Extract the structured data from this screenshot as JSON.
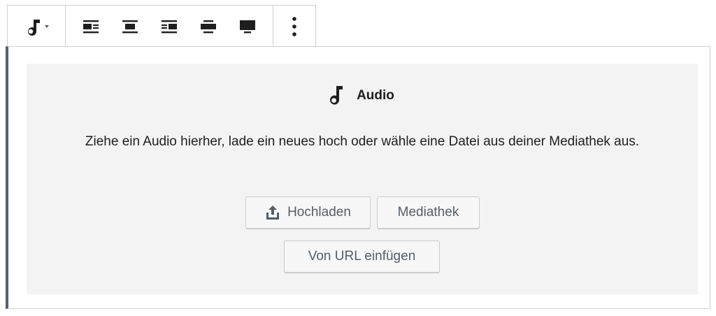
{
  "block": {
    "title": "Audio",
    "instructions": "Ziehe ein Audio hierher, lade ein neues hoch oder wähle eine Datei aus deiner Mediathek aus.",
    "upload_label": "Hochladen",
    "library_label": "Mediathek",
    "url_label": "Von URL einfügen"
  },
  "toolbar": {
    "icons": [
      "music-note-icon",
      "dropdown-caret-icon",
      "align-left-icon",
      "align-center-icon",
      "align-right-icon",
      "align-wide-icon",
      "align-full-icon",
      "more-options-icon"
    ]
  },
  "colors": {
    "frame_accent": "#5a6069",
    "placeholder_bg": "#f3f3f3",
    "button_text": "#555d66",
    "icon": "#1e1e1e"
  }
}
